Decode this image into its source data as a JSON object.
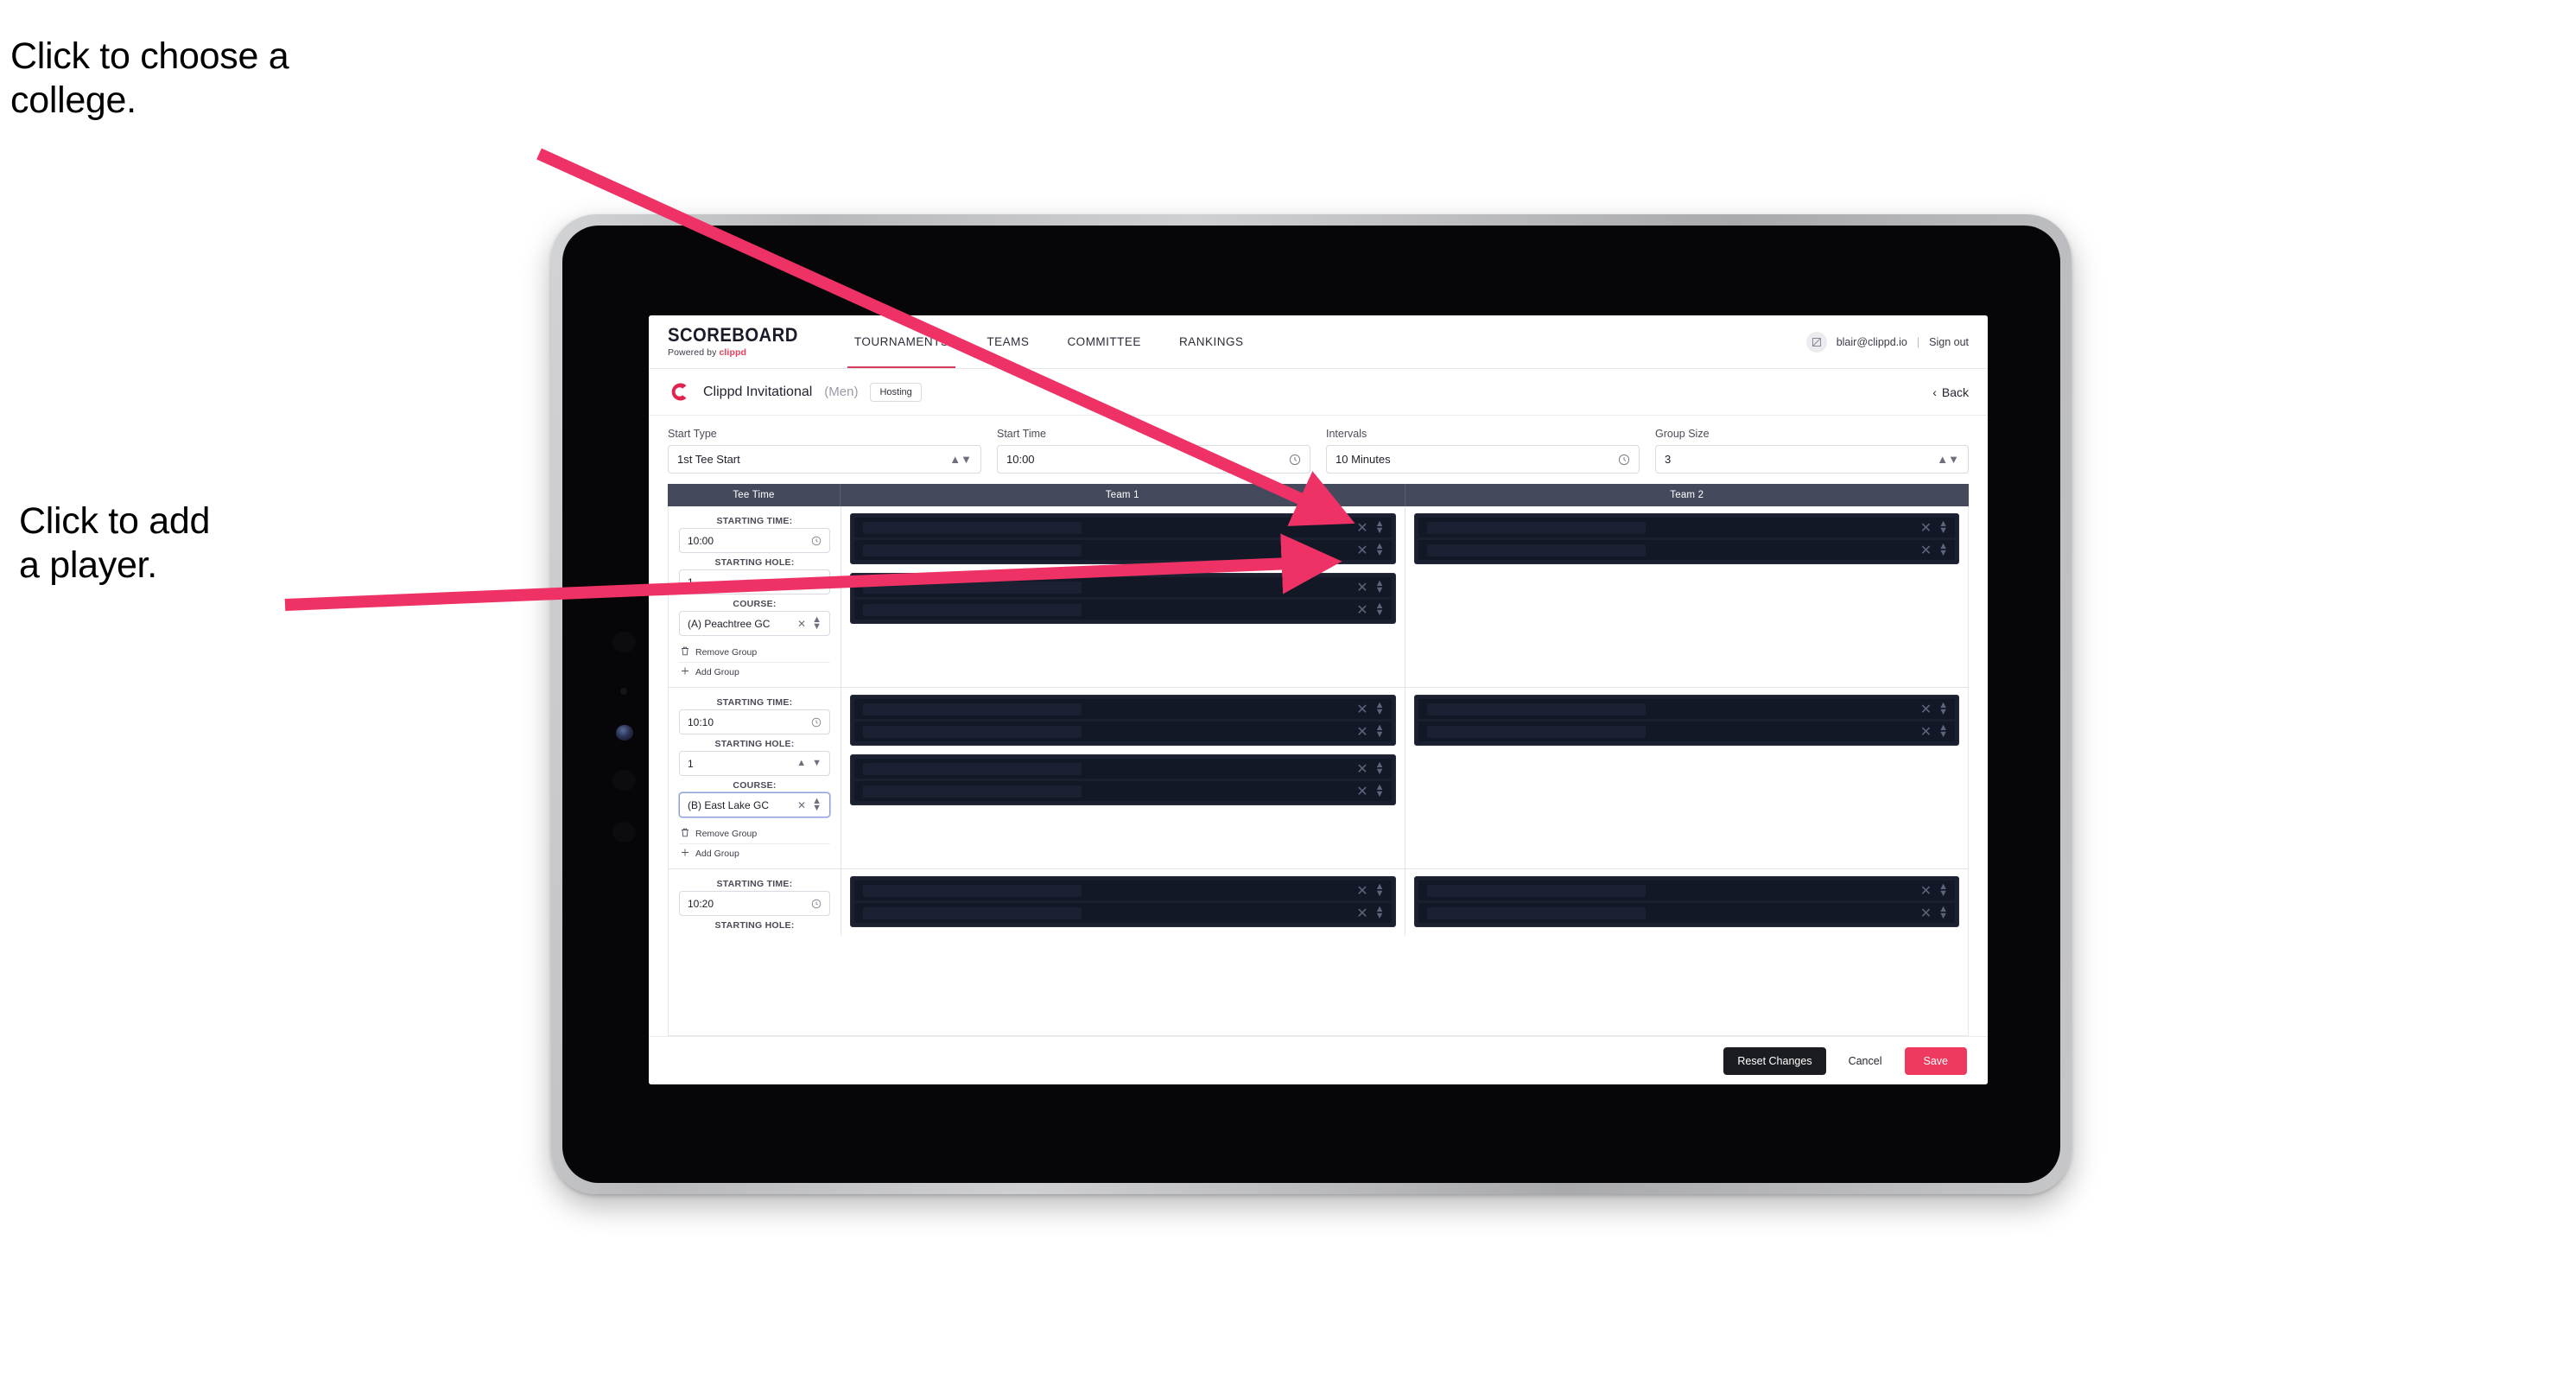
{
  "annotations": {
    "college": "Click to choose a\ncollege.",
    "player": "Click to add\na player.",
    "arrow_color": "#EE3266"
  },
  "topnav": {
    "brand_word": "SCOREBOARD",
    "brand_sub_prefix": "Powered by ",
    "brand_sub_accent": "clippd",
    "items": [
      {
        "label": "TOURNAMENTS",
        "active": true
      },
      {
        "label": "TEAMS",
        "active": false
      },
      {
        "label": "COMMITTEE",
        "active": false
      },
      {
        "label": "RANKINGS",
        "active": false
      }
    ],
    "avatar_icon": "user-avatar-icon",
    "email": "blair@clippd.io",
    "separator": "|",
    "sign_out": "Sign out"
  },
  "tourney": {
    "logo_icon": "clippd-c-logo",
    "name": "Clippd Invitational",
    "gender": "(Men)",
    "hosting_chip": "Hosting",
    "back_label": "Back",
    "back_icon": "chevron-left-icon"
  },
  "settings": {
    "fields": [
      {
        "label": "Start Type",
        "value": "1st Tee Start",
        "adorn": "stepper-icon"
      },
      {
        "label": "Start Time",
        "value": "10:00",
        "adorn": "clock-icon"
      },
      {
        "label": "Intervals",
        "value": "10 Minutes",
        "adorn": "clock-icon"
      },
      {
        "label": "Group Size",
        "value": "3",
        "adorn": "stepper-icon"
      }
    ]
  },
  "table": {
    "headers": [
      "Tee Time",
      "Team 1",
      "Team 2"
    ],
    "labels": {
      "starting_time": "STARTING TIME:",
      "starting_hole": "STARTING HOLE:",
      "course": "COURSE:",
      "remove_group": "Remove Group",
      "add_group": "Add Group",
      "remove_icon": "trash-icon",
      "add_icon": "plus-icon",
      "clock_icon": "clock-icon",
      "stepper_icon": "stepper-icon",
      "clear_icon": "clear-x-icon"
    },
    "groups": [
      {
        "starting_time": "10:00",
        "starting_hole": "1",
        "course": "(A) Peachtree GC",
        "course_focused": false,
        "team1_blocks": [
          2,
          2
        ],
        "team2_blocks": [
          2
        ]
      },
      {
        "starting_time": "10:10",
        "starting_hole": "1",
        "course": "(B) East Lake GC",
        "course_focused": true,
        "team1_blocks": [
          2,
          2
        ],
        "team2_blocks": [
          2
        ]
      },
      {
        "starting_time": "10:20",
        "starting_hole": "",
        "course": "",
        "course_focused": false,
        "team1_blocks": [
          2
        ],
        "team2_blocks": [
          2
        ]
      }
    ]
  },
  "footer": {
    "reset": "Reset Changes",
    "cancel": "Cancel",
    "save": "Save"
  },
  "colors": {
    "accent_pink": "#EE3A5F",
    "nav_underline": "#D63A5C",
    "table_header_bg": "#444A5C",
    "player_block_bg": "#1B2030",
    "player_row_bg": "#131827"
  }
}
